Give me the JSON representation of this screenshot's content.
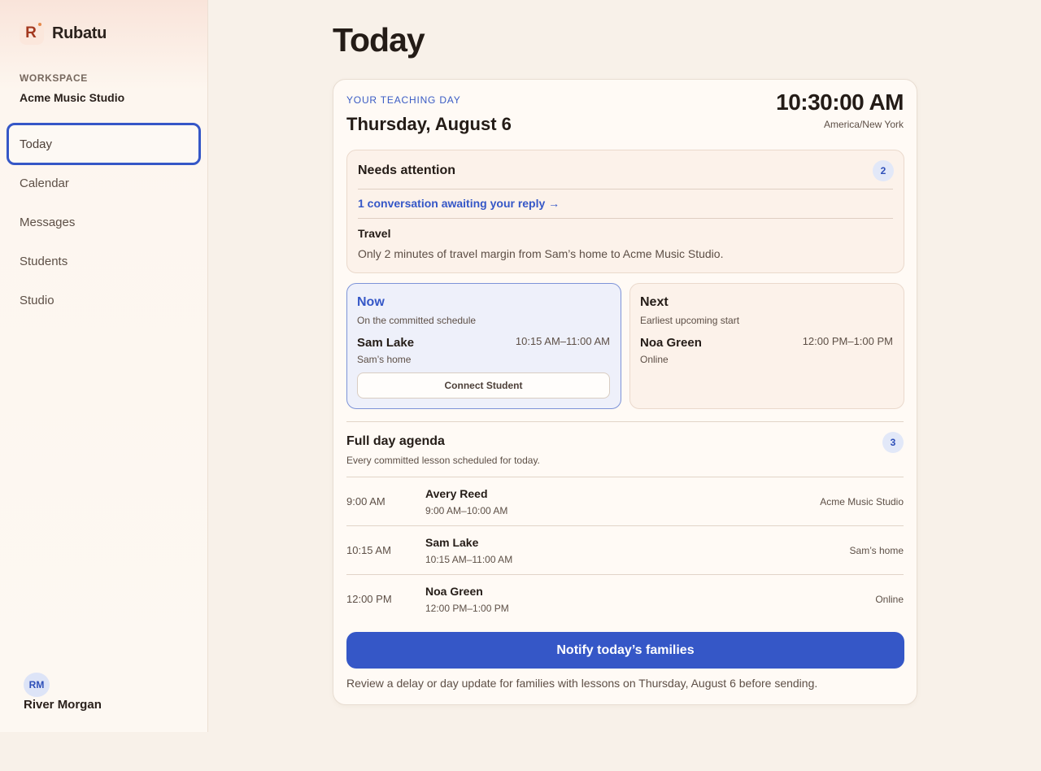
{
  "brand": {
    "name": "Rubatu",
    "mark": "R"
  },
  "workspace": {
    "label": "WORKSPACE",
    "name": "Acme Music Studio"
  },
  "nav": [
    {
      "label": "Today",
      "active": true
    },
    {
      "label": "Calendar"
    },
    {
      "label": "Messages"
    },
    {
      "label": "Students"
    },
    {
      "label": "Studio"
    }
  ],
  "user": {
    "initials": "RM",
    "name": "River Morgan"
  },
  "page": {
    "title": "Today"
  },
  "day": {
    "eyebrow": "YOUR TEACHING DAY",
    "date": "Thursday, August 6",
    "clock": "10:30:00 AM",
    "timezone": "America/New York"
  },
  "attention": {
    "title": "Needs attention",
    "count": "2",
    "link": "1 conversation awaiting your reply →",
    "travel_title": "Travel",
    "travel_text": "Only 2 minutes of travel margin from Sam’s home to Acme Music Studio."
  },
  "now": {
    "title": "Now",
    "subtitle": "On the committed schedule",
    "student": "Sam Lake",
    "time": "10:15 AM–11:00 AM",
    "location": "Sam’s home",
    "button": "Connect Student"
  },
  "next": {
    "title": "Next",
    "subtitle": "Earliest upcoming start",
    "student": "Noa Green",
    "time": "12:00 PM–1:00 PM",
    "location": "Online"
  },
  "agenda": {
    "title": "Full day agenda",
    "count": "3",
    "subtitle": "Every committed lesson scheduled for today.",
    "rows": [
      {
        "start": "9:00 AM",
        "student": "Avery Reed",
        "range": "9:00 AM–10:00 AM",
        "location": "Acme Music Studio"
      },
      {
        "start": "10:15 AM",
        "student": "Sam Lake",
        "range": "10:15 AM–11:00 AM",
        "location": "Sam’s home"
      },
      {
        "start": "12:00 PM",
        "student": "Noa Green",
        "range": "12:00 PM–1:00 PM",
        "location": "Online"
      }
    ]
  },
  "notify": {
    "button": "Notify today’s families",
    "note": "Review a delay or day update for families with lessons on Thursday, August 6 before sending."
  },
  "colors": {
    "accent": "#3557c7",
    "background": "#f8f1e9",
    "brand": "#a3381f"
  }
}
